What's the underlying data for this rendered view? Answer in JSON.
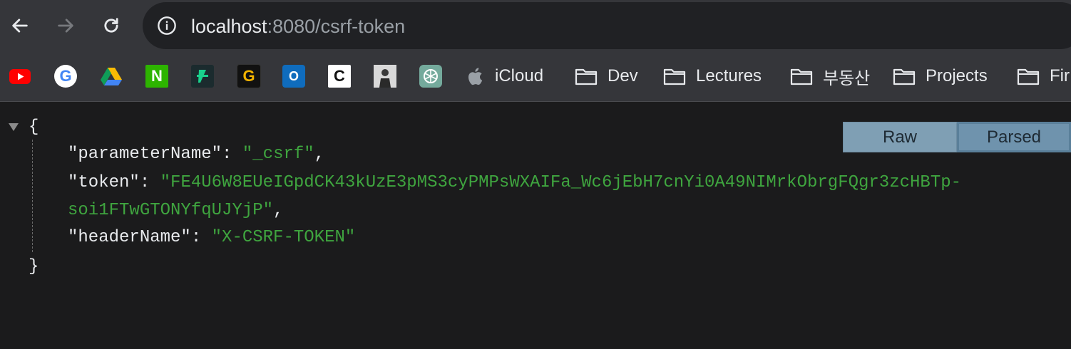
{
  "toolbar": {
    "back_icon": "arrow-left-icon",
    "forward_icon": "arrow-right-icon",
    "reload_icon": "reload-icon",
    "info_icon": "info-icon",
    "url_host": "localhost",
    "url_rest": ":8080/csrf-token"
  },
  "bookmarks": {
    "items": [
      {
        "icon": "youtube-icon",
        "label": ""
      },
      {
        "icon": "google-icon",
        "label": "G"
      },
      {
        "icon": "google-drive-icon",
        "label": ""
      },
      {
        "icon": "n-icon",
        "label": "N"
      },
      {
        "icon": "slash-icon",
        "label": ""
      },
      {
        "icon": "g-icon",
        "label": "G"
      },
      {
        "icon": "outlook-icon",
        "label": "O"
      },
      {
        "icon": "c-icon",
        "label": "C"
      },
      {
        "icon": "profile-photo-icon",
        "label": ""
      },
      {
        "icon": "chatgpt-icon",
        "label": ""
      },
      {
        "icon": "apple-icon",
        "label": "iCloud"
      },
      {
        "icon": "folder-icon",
        "label": "Dev"
      },
      {
        "icon": "folder-icon",
        "label": "Lectures"
      },
      {
        "icon": "folder-icon",
        "label": "부동산"
      },
      {
        "icon": "folder-icon",
        "label": "Projects"
      },
      {
        "icon": "folder-icon",
        "label": "Fir"
      }
    ]
  },
  "json": {
    "open_brace": "{",
    "close_brace": "}",
    "rows": [
      {
        "key": "\"parameterName\"",
        "value": "\"_csrf\"",
        "trail": ","
      },
      {
        "key": "\"token\"",
        "value": "\"FE4U6W8EUeIGpdCK43kUzE3pMS3cyPMPsWXAIFa_Wc6jEbH7cnYi0A49NIMrkObrgFQgr3zcHBTp-",
        "trail": ""
      },
      {
        "key": "",
        "value": "soi1FTwGTONYfqUJYjP\"",
        "trail": ","
      },
      {
        "key": "\"headerName\"",
        "value": "\"X-CSRF-TOKEN\"",
        "trail": ""
      }
    ],
    "colon": ": "
  },
  "view_toggle": {
    "raw_label": "Raw",
    "parsed_label": "Parsed",
    "selected": "Parsed"
  },
  "colors": {
    "string": "#3fa53f",
    "toggle_bg": "#7f9fb4"
  }
}
